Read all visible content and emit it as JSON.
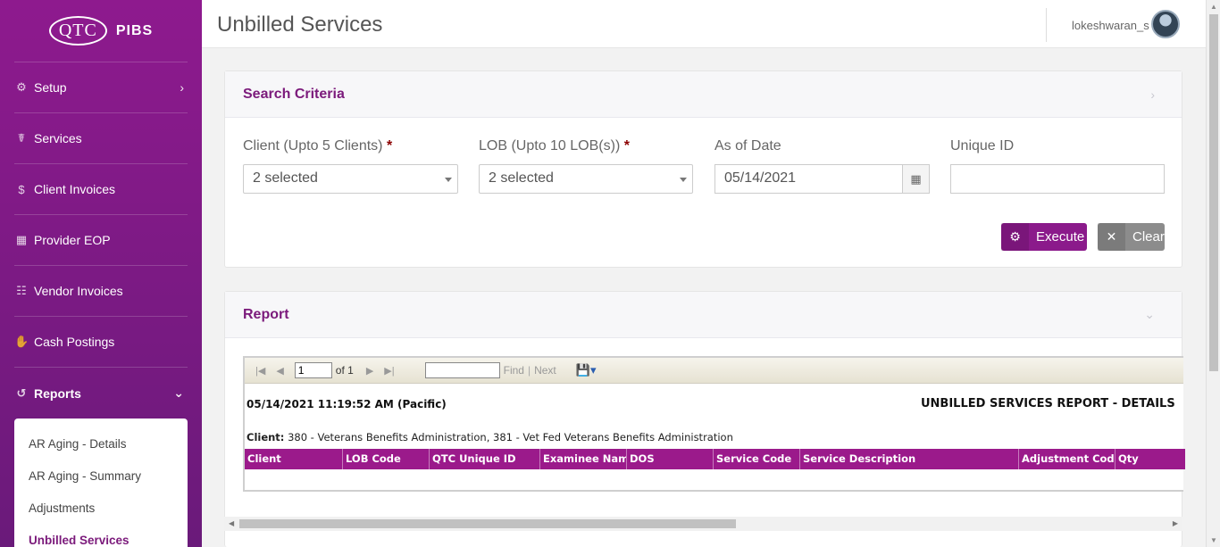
{
  "brand": {
    "logo_mark": "QTC",
    "app_name": "PIBS"
  },
  "sidebar": {
    "items": [
      {
        "label": "Setup",
        "icon": "gear-icon"
      },
      {
        "label": "Services",
        "icon": "stethoscope-icon"
      },
      {
        "label": "Client Invoices",
        "icon": "dollar-icon"
      },
      {
        "label": "Provider EOP",
        "icon": "calendar-icon"
      },
      {
        "label": "Vendor Invoices",
        "icon": "table-icon"
      },
      {
        "label": "Cash Postings",
        "icon": "hand-coin-icon"
      },
      {
        "label": "Reports",
        "icon": "history-icon"
      }
    ],
    "submenu": [
      "AR Aging - Details",
      "AR Aging - Summary",
      "Adjustments",
      "Unbilled Services"
    ]
  },
  "header": {
    "title": "Unbilled Services",
    "username": "lokeshwaran_s"
  },
  "search": {
    "title": "Search Criteria",
    "client_label": "Client (Upto 5 Clients)",
    "client_value": "2 selected",
    "lob_label": "LOB (Upto 10 LOB(s))",
    "lob_value": "2 selected",
    "date_label": "As of Date",
    "date_value": "05/14/2021",
    "uid_label": "Unique ID",
    "uid_value": "",
    "required_mark": "*",
    "execute_label": "Execute",
    "clear_label": "Clear"
  },
  "report": {
    "title": "Report",
    "toolbar": {
      "page": "1",
      "of_text": "of 1",
      "find": "Find",
      "sep": "|",
      "next": "Next"
    },
    "run_date": "05/14/2021 11:19:52 AM (Pacific)",
    "report_title": "UNBILLED SERVICES REPORT - DETAILS",
    "client_label": "Client:",
    "client_text": "380 - Veterans Benefits Administration, 381 - Vet Fed Veterans Benefits Administration",
    "columns": [
      "Client",
      "LOB Code",
      "QTC Unique ID",
      "Examinee Name",
      "DOS",
      "Service Code",
      "Service Description",
      "Adjustment Code",
      "Qty"
    ]
  },
  "colors": {
    "brand_purple": "#8b1a8b",
    "header_purple": "#9b1a8b",
    "title_purple": "#7b1a7b"
  }
}
